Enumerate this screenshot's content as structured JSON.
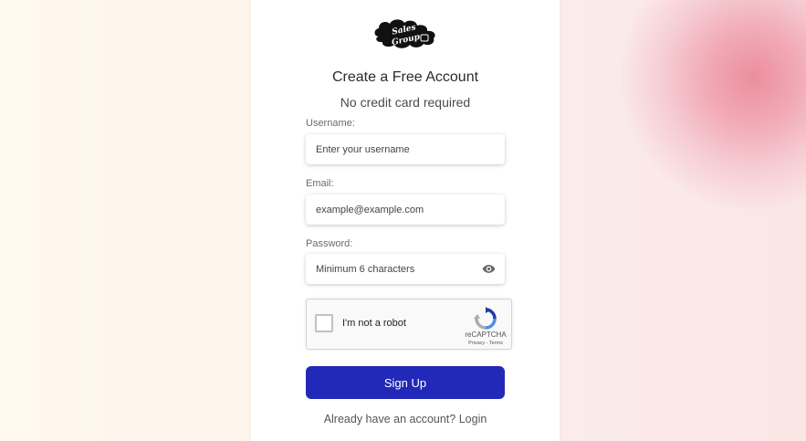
{
  "brand": {
    "logo_line1": "Sales",
    "logo_line2": "Group"
  },
  "form": {
    "title": "Create a Free Account",
    "subtitle": "No credit card required",
    "username": {
      "label": "Username:",
      "placeholder": "Enter your username",
      "value": ""
    },
    "email": {
      "label": "Email:",
      "placeholder": "example@example.com",
      "value": ""
    },
    "password": {
      "label": "Password:",
      "placeholder": "Minimum 6 characters",
      "value": ""
    },
    "submit_label": "Sign Up",
    "login_prompt": "Already have an account?",
    "login_link": "Login"
  },
  "captcha": {
    "label": "I'm not a robot",
    "brand": "reCAPTCHA",
    "privacy": "Privacy",
    "separator": " - ",
    "terms": "Terms",
    "checked": false
  },
  "colors": {
    "primary": "#2229b8",
    "background_left": "#fff8ec",
    "background_right": "#fbe6e6",
    "accent_blob": "#ec8e9e"
  },
  "icons": {
    "password_toggle": "eye-icon",
    "captcha": "recaptcha-icon"
  }
}
